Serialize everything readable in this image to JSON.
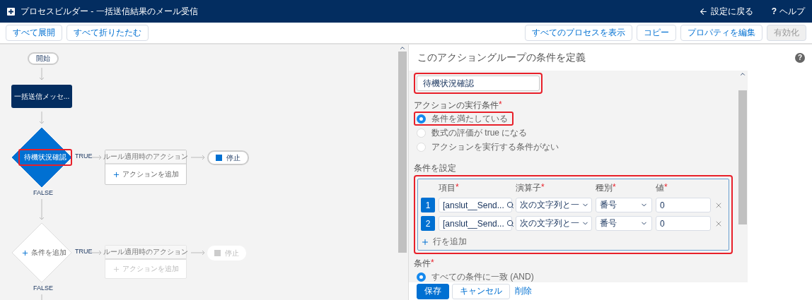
{
  "header": {
    "title": "プロセスビルダー - 一括送信結果のメール受信",
    "back_link": "設定に戻る",
    "help_icon": "?",
    "help_link": "ヘルプ"
  },
  "toolbar": {
    "left_buttons": [
      {
        "label": "すべて展開",
        "disabled": false
      },
      {
        "label": "すべて折りたたむ",
        "disabled": false
      }
    ],
    "right_buttons": [
      {
        "label": "すべてのプロセスを表示",
        "disabled": false
      },
      {
        "label": "コピー",
        "disabled": false
      },
      {
        "label": "プロパティを編集",
        "disabled": false
      },
      {
        "label": "有効化",
        "disabled": true
      }
    ]
  },
  "flow": {
    "start": "開始",
    "trigger": "一括送信メッセ...",
    "criteria": [
      {
        "kind": "defined",
        "label": "待機状況確認",
        "highlighted": true,
        "true_label": "TRUE",
        "false_label": "FALSE",
        "action_group": {
          "title": "ルール適用時のアクション",
          "add_action": "アクションを追加",
          "disabled": false
        },
        "stop": {
          "label": "停止",
          "disabled": false
        }
      },
      {
        "kind": "add",
        "label": "条件を追加",
        "highlighted": false,
        "true_label": "TRUE",
        "false_label": "FALSE",
        "action_group": {
          "title": "ルール適用時のアクション",
          "add_action": "アクションを追加",
          "disabled": true
        },
        "stop": {
          "label": "停止",
          "disabled": true
        }
      }
    ]
  },
  "panel": {
    "title": "このアクショングループの条件を定義",
    "help_icon": "?",
    "criteria_name": {
      "value": "待機状況確認",
      "highlighted": true
    },
    "execution": {
      "label": "アクションの実行条件",
      "required_mark": "*",
      "options": [
        {
          "label": "条件を満たしている",
          "selected": true,
          "highlighted": true
        },
        {
          "label": "数式の評価が true になる",
          "selected": false,
          "highlighted": false
        },
        {
          "label": "アクションを実行する条件がない",
          "selected": false,
          "highlighted": false
        }
      ]
    },
    "conditions": {
      "label": "条件を設定",
      "highlighted": true,
      "columns": [
        {
          "label": "項目",
          "required_mark": "*"
        },
        {
          "label": "演算子",
          "required_mark": "*"
        },
        {
          "label": "種別",
          "required_mark": "*"
        },
        {
          "label": "値",
          "required_mark": "*"
        }
      ],
      "rows": [
        {
          "number": "1",
          "field": "[anslut__Send...",
          "operator": "次の文字列と一",
          "type": "番号",
          "value": "0"
        },
        {
          "number": "2",
          "field": "[anslut__Send...",
          "operator": "次の文字列と一",
          "type": "番号",
          "value": "0"
        }
      ],
      "add_row": "行を追加"
    },
    "logic": {
      "label": "条件",
      "required_mark": "*",
      "options": [
        {
          "label": "すべての条件に一致 (AND)",
          "selected": true
        }
      ]
    },
    "footer_buttons": [
      {
        "kind": "primary",
        "label": "保存"
      },
      {
        "kind": "neutral",
        "label": "キャンセル"
      },
      {
        "kind": "link",
        "label": "削除"
      }
    ]
  }
}
